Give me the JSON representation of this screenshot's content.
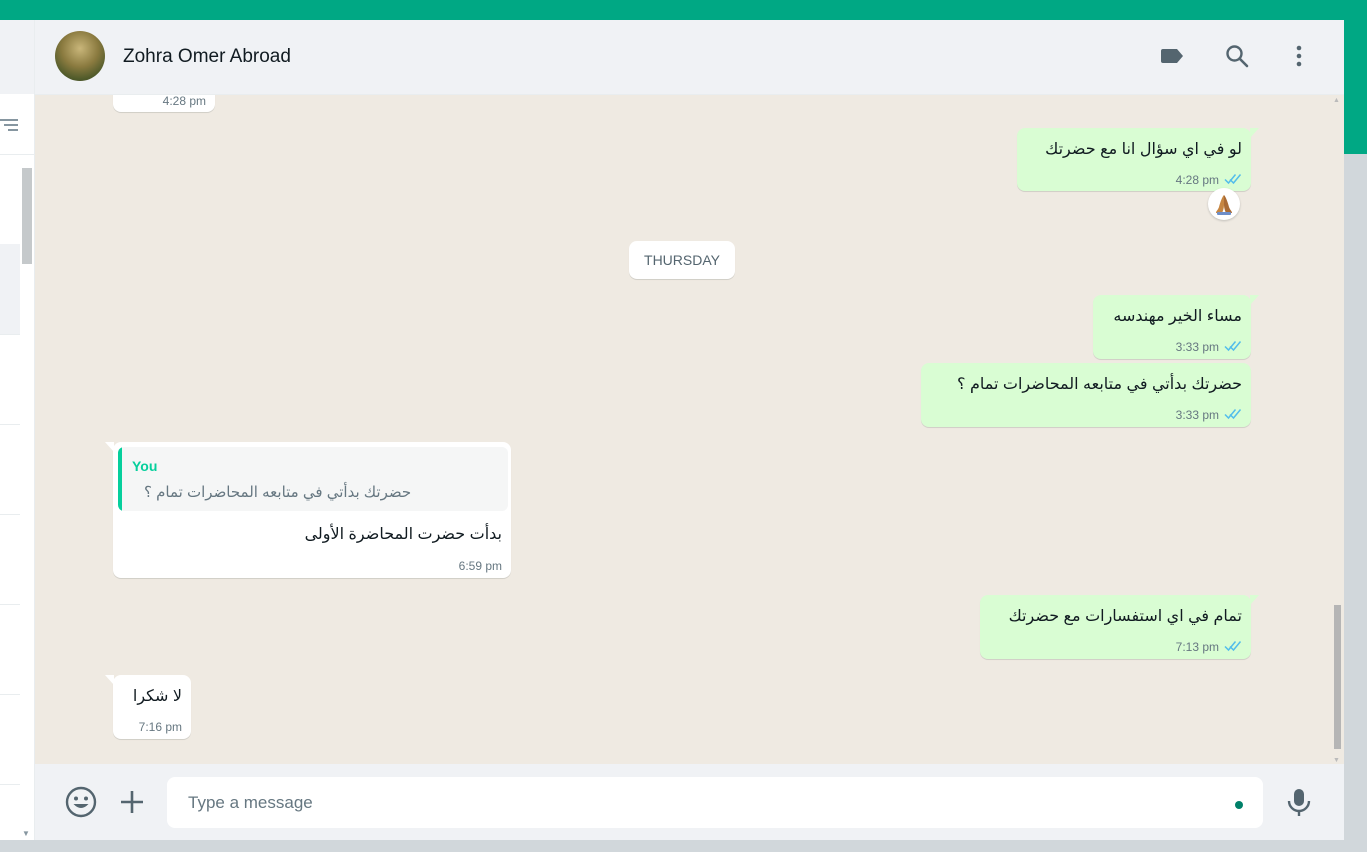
{
  "header": {
    "contact_name": "Zohra Omer Abroad",
    "avatar_icon": "profile-photo",
    "icons": [
      "label-icon",
      "search-icon",
      "menu-icon"
    ]
  },
  "messages": {
    "m0": {
      "direction": "in",
      "time": "4:28 pm"
    },
    "m1": {
      "direction": "out",
      "text": "لو في اي سؤال انا مع حضرتك",
      "time": "4:28 pm",
      "status": "read",
      "reaction": "🙏🏽"
    },
    "date_separator": "THURSDAY",
    "m2": {
      "direction": "out",
      "text": "مساء الخير مهندسه",
      "time": "3:33 pm",
      "status": "read"
    },
    "m3": {
      "direction": "out",
      "text": "حضرتك بدأتي في متابعه المحاضرات تمام ؟",
      "time": "3:33 pm",
      "status": "read"
    },
    "m4": {
      "direction": "in",
      "quote": {
        "author": "You",
        "text": "حضرتك بدأتي في متابعه المحاضرات تمام ؟"
      },
      "text": "بدأت حضرت المحاضرة الأولى",
      "time": "6:59 pm"
    },
    "m5": {
      "direction": "out",
      "text": "تمام في اي استفسارات مع حضرتك",
      "time": "7:13 pm",
      "status": "read"
    },
    "m6": {
      "direction": "in",
      "text": "لا شكرا",
      "time": "7:16 pm"
    }
  },
  "composer": {
    "placeholder": "Type a message",
    "icons": [
      "emoji-icon",
      "attach-plus-icon",
      "microphone-icon"
    ]
  },
  "colors": {
    "accent": "#00a884",
    "outgoing_bubble": "#d9fdd3",
    "incoming_bubble": "#ffffff",
    "read_ticks": "#53bdeb",
    "wallpaper": "#efeae2"
  }
}
